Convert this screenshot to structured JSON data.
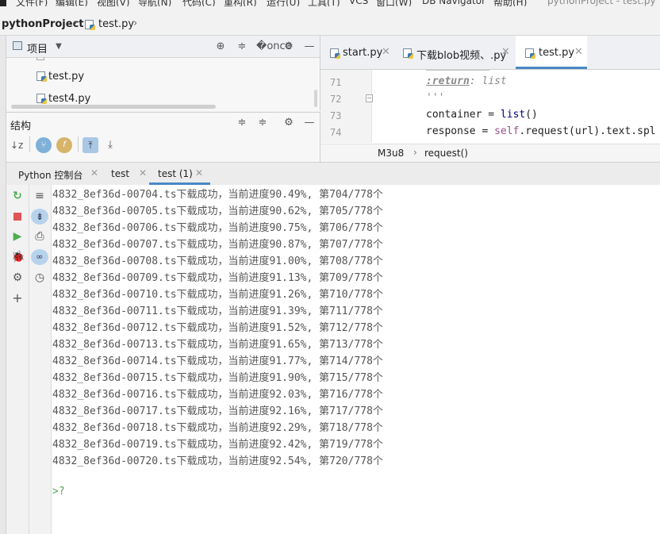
{
  "menu": {
    "items": [
      "文件(F)",
      "编辑(E)",
      "视图(V)",
      "导航(N)",
      "代码(C)",
      "重构(R)",
      "运行(U)",
      "工具(T)",
      "VCS",
      "窗口(W)",
      "DB Navigator",
      "帮助(H)"
    ],
    "window_title": "pythonProject - test.py"
  },
  "breadcrumb": {
    "project": "pythonProject",
    "file": "test.py"
  },
  "project_panel": {
    "title": "项目",
    "items": [
      "test.py",
      "test4.py"
    ]
  },
  "structure_panel": {
    "title": "结构"
  },
  "editor": {
    "tabs": [
      {
        "label": "start.py"
      },
      {
        "label": "下载blob视频、.py"
      },
      {
        "label": "test.py"
      }
    ],
    "active_tab": "test.py",
    "line_numbers": [
      "71",
      "72",
      "73",
      "74"
    ],
    "code": {
      "line71_tag": ":return",
      "line71_type": ": list",
      "line72": "'''",
      "line73_a": "container = ",
      "line73_fn": "list",
      "line73_b": "()",
      "line74_a": "response = ",
      "line74_self": "self",
      "line74_b": ".request(url).text.spl"
    },
    "crumbs": {
      "class": "M3u8",
      "method": "request()"
    }
  },
  "run_window": {
    "tabs": [
      "Python 控制台",
      "test",
      "test (1)"
    ],
    "active_tab": "test (1)",
    "console_lines": [
      "4832_8ef36d-00704.ts下载成功，当前进度90.49%, 第704/778个",
      "4832_8ef36d-00705.ts下载成功，当前进度90.62%, 第705/778个",
      "4832_8ef36d-00706.ts下载成功，当前进度90.75%, 第706/778个",
      "4832_8ef36d-00707.ts下载成功，当前进度90.87%, 第707/778个",
      "4832_8ef36d-00708.ts下载成功，当前进度91.00%, 第708/778个",
      "4832_8ef36d-00709.ts下载成功，当前进度91.13%, 第709/778个",
      "4832_8ef36d-00710.ts下载成功，当前进度91.26%, 第710/778个",
      "4832_8ef36d-00711.ts下载成功，当前进度91.39%, 第711/778个",
      "4832_8ef36d-00712.ts下载成功，当前进度91.52%, 第712/778个",
      "4832_8ef36d-00713.ts下载成功，当前进度91.65%, 第713/778个",
      "4832_8ef36d-00714.ts下载成功，当前进度91.77%, 第714/778个",
      "4832_8ef36d-00715.ts下载成功，当前进度91.90%, 第715/778个",
      "4832_8ef36d-00716.ts下载成功，当前进度92.03%, 第716/778个",
      "4832_8ef36d-00717.ts下载成功，当前进度92.16%, 第717/778个",
      "4832_8ef36d-00718.ts下载成功，当前进度92.29%, 第718/778个",
      "4832_8ef36d-00719.ts下载成功，当前进度92.42%, 第719/778个",
      "4832_8ef36d-00720.ts下载成功，当前进度92.54%, 第720/778个"
    ],
    "prompt": ">?"
  },
  "colors": {
    "accent": "#4a88c7",
    "run_green": "#4caf50",
    "stop_red": "#e05555",
    "debug_green": "#59a869"
  }
}
